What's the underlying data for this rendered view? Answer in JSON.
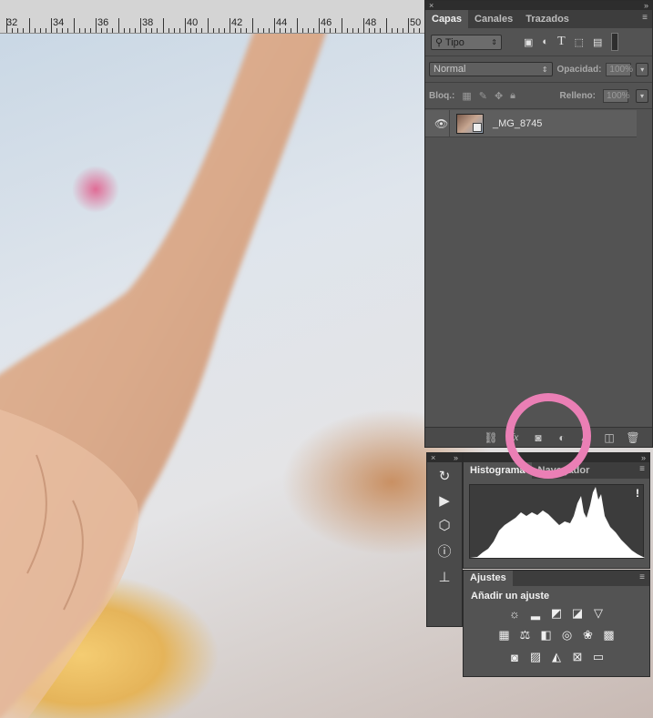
{
  "ruler": {
    "labels": [
      "32",
      "34",
      "36",
      "38",
      "40",
      "42",
      "44",
      "46",
      "48",
      "50"
    ]
  },
  "layers_panel": {
    "close_icon": "×",
    "tabs": [
      {
        "label": "Capas",
        "active": true
      },
      {
        "label": "Canales",
        "active": false
      },
      {
        "label": "Trazados",
        "active": false
      }
    ],
    "filter": {
      "label": "Tipo",
      "icon": "search-icon"
    },
    "blend_mode": "Normal",
    "opacity_label": "Opacidad:",
    "opacity_value": "100%",
    "lock_label": "Bloq.:",
    "fill_label": "Relleno:",
    "fill_value": "100%",
    "layer": {
      "name": "_MG_8745",
      "visible": true
    }
  },
  "histogram_panel": {
    "tabs": [
      {
        "label": "Histograma",
        "active": true
      },
      {
        "label": "Navegador",
        "active": false
      }
    ],
    "warning_icon": "!"
  },
  "adjustments_panel": {
    "tab": "Ajustes",
    "heading": "Añadir un ajuste"
  },
  "colors": {
    "panel_bg": "#535353",
    "highlight_ring": "#ea7fb5"
  }
}
